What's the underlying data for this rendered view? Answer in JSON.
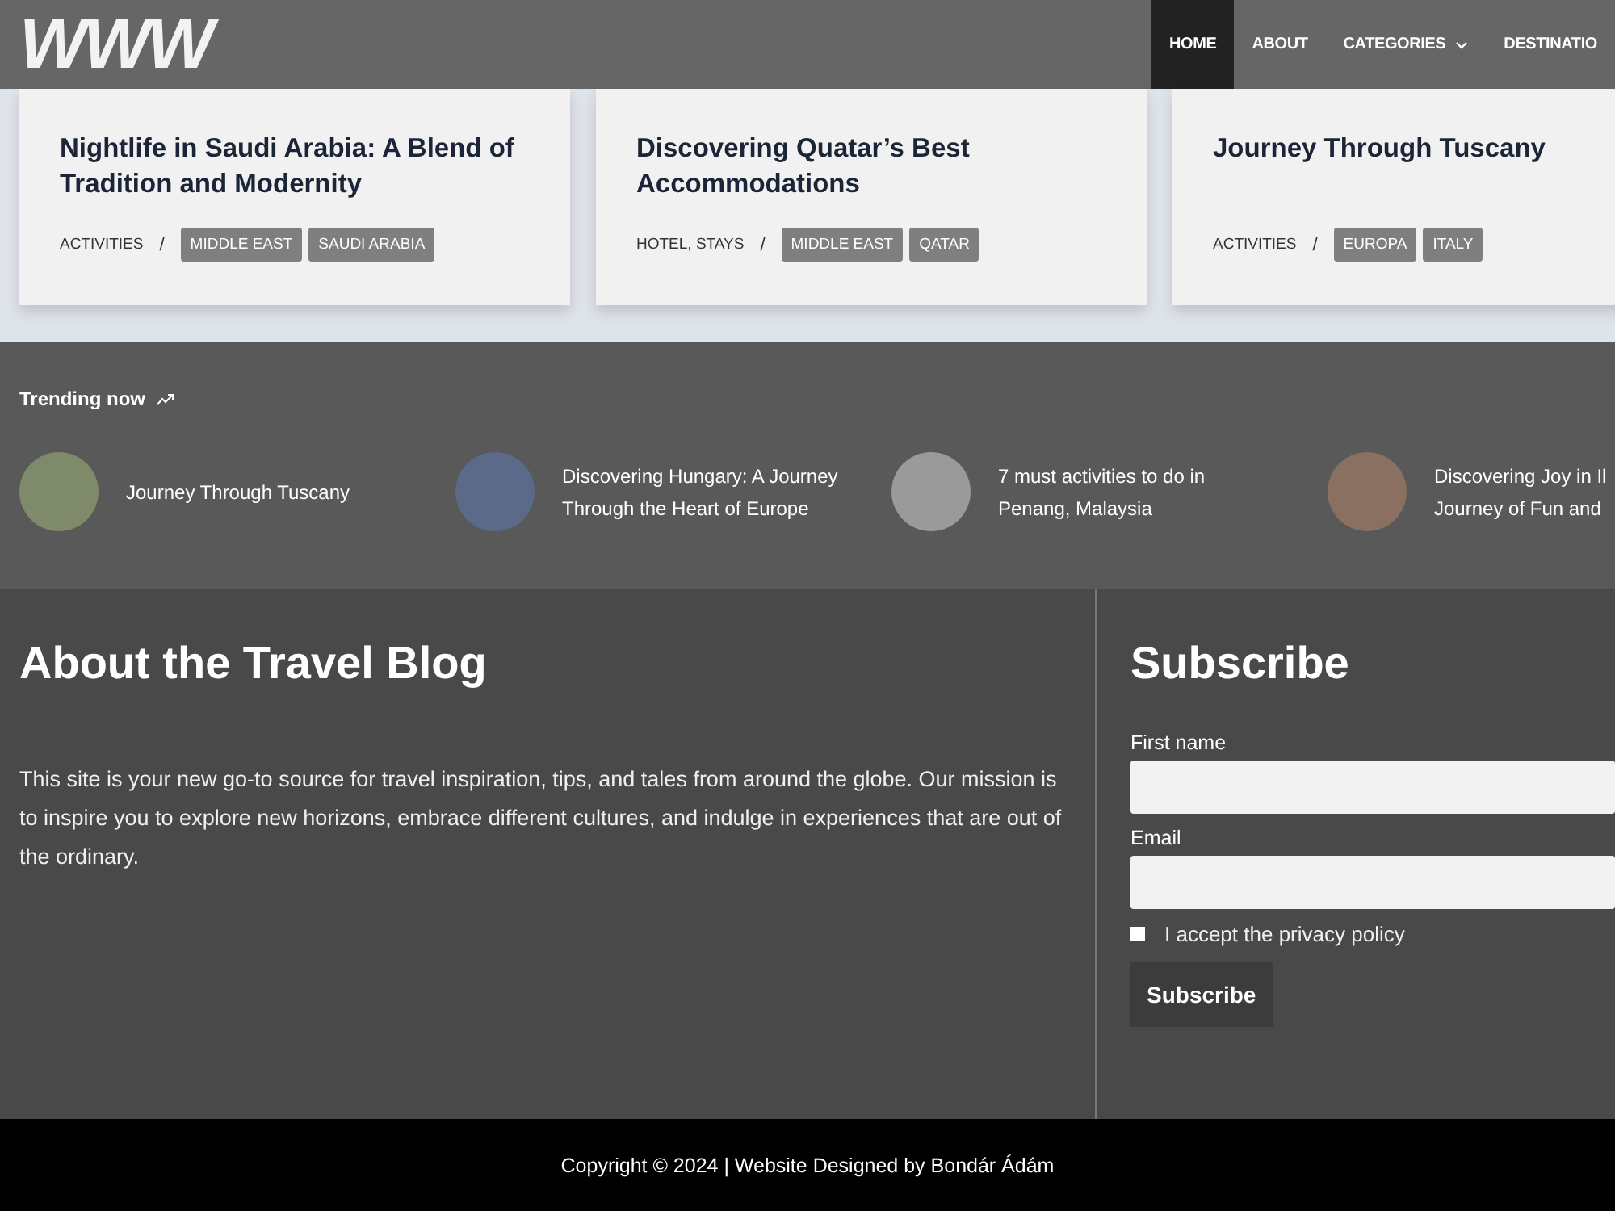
{
  "header": {
    "logo": "WWW",
    "nav": [
      {
        "label": "HOME",
        "selected": true,
        "dropdown": false
      },
      {
        "label": "ABOUT",
        "selected": false,
        "dropdown": false
      },
      {
        "label": "CATEGORIES",
        "selected": false,
        "dropdown": true
      },
      {
        "label": "DESTINATIO",
        "selected": false,
        "dropdown": false
      }
    ]
  },
  "cards": [
    {
      "title": "Nightlife in Saudi Arabia: A Blend of Tradition and Modernity",
      "category": "ACTIVITIES",
      "separator": "/",
      "tags": [
        "MIDDLE EAST",
        "SAUDI ARABIA"
      ]
    },
    {
      "title": "Discovering Quatar’s Best Accommodations",
      "category": "HOTEL, STAYS",
      "separator": "/",
      "tags": [
        "MIDDLE EAST",
        "QATAR"
      ]
    },
    {
      "title": "Journey Through Tuscany",
      "category": "ACTIVITIES",
      "separator": "/",
      "tags": [
        "EUROPA",
        "ITALY"
      ]
    }
  ],
  "trending": {
    "title": "Trending now",
    "items": [
      {
        "title": "Journey Through Tuscany"
      },
      {
        "title": "Discovering Hungary: A Journey Through the Heart of Europe"
      },
      {
        "title": "7 must activities to do in Penang, Malaysia"
      },
      {
        "title": "Discovering Joy in Il Journey of Fun and"
      }
    ]
  },
  "about": {
    "title": "About the Travel Blog",
    "text": "This site is your new go-to source for travel inspiration, tips, and tales from around the globe. Our mission is to inspire you to explore new horizons, embrace different cultures, and indulge in experiences that are out of the ordinary."
  },
  "subscribe": {
    "title": "Subscribe",
    "fields": [
      {
        "label": "First name"
      },
      {
        "label": "Email"
      }
    ],
    "consent": {
      "label": "I accept the privacy policy",
      "checked": false
    },
    "button": "Subscribe"
  },
  "footer": {
    "copyright": "Copyright © 2024 | Website Designed by Bondár Ádám"
  }
}
